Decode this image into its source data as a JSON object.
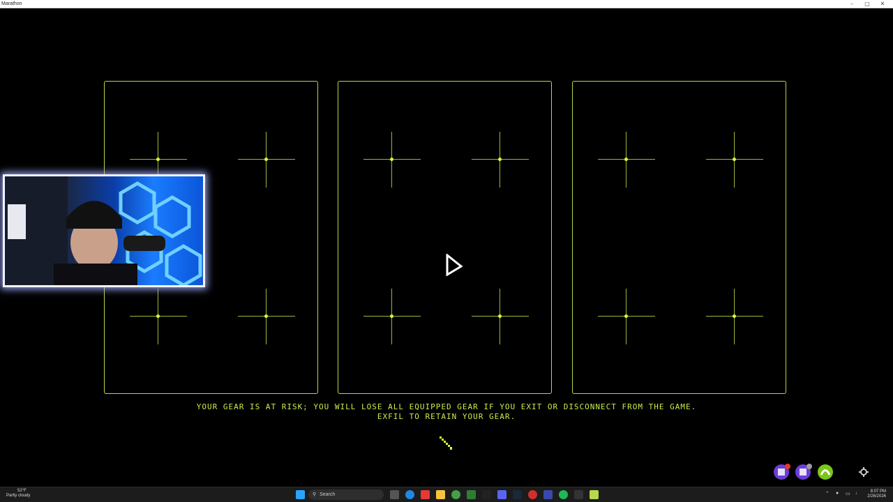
{
  "window": {
    "title": "Marathon",
    "minimize_glyph": "–",
    "maximize_glyph": "□",
    "close_glyph": "✕"
  },
  "game": {
    "warning_line1": "YOUR GEAR IS AT RISK; YOU WILL LOSE ALL EQUIPPED GEAR IF YOU EXIT OR DISCONNECT FROM THE GAME.",
    "warning_line2": "EXFIL TO RETAIN YOUR GEAR.",
    "accent_color": "#b6d84a",
    "slot_panels": 3
  },
  "overlay": {
    "webcam_icon": "webcam-feed"
  },
  "taskbar": {
    "weather_temp": "52°F",
    "weather_desc": "Partly cloudy",
    "search_label": "Search",
    "clock_time": "8:07 PM",
    "clock_date": "2/26/2026"
  },
  "colors": {
    "background": "#000000",
    "panel_border": "#b6d84a",
    "text_accent": "#c9ec4a",
    "taskbar": "#1c1c1c"
  }
}
